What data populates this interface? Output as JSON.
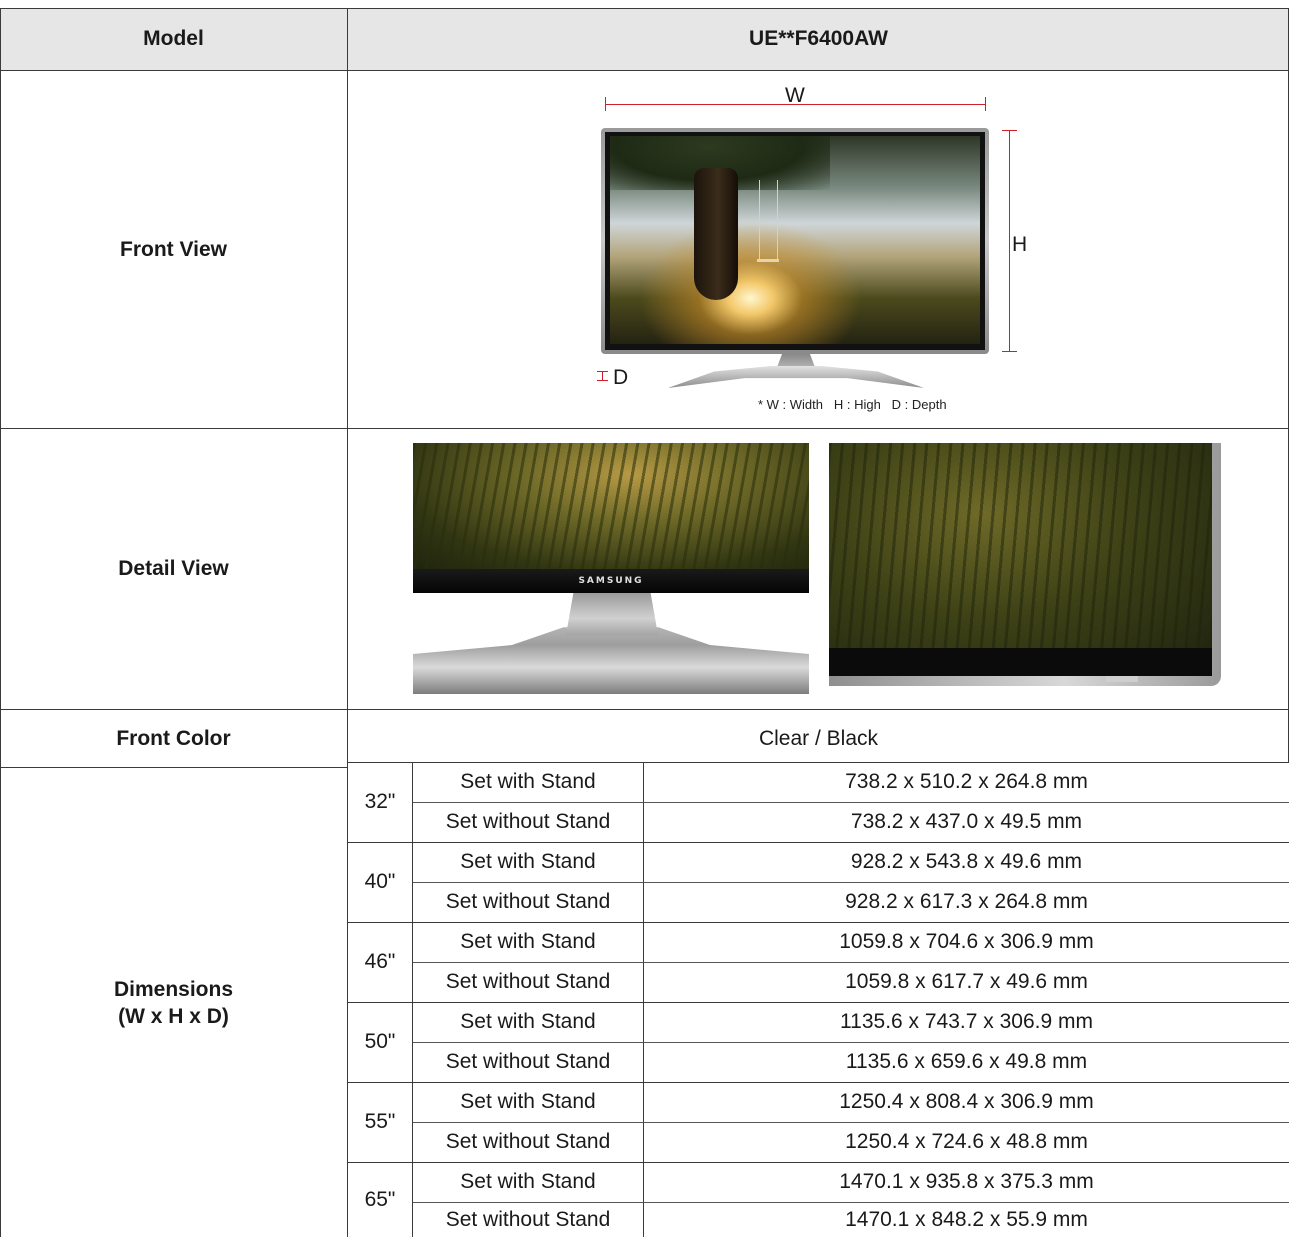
{
  "header": {
    "label": "Model",
    "model": "UE**F6400AW"
  },
  "front_view": {
    "label": "Front View",
    "width_marker": "W",
    "height_marker": "H",
    "depth_marker": "D",
    "legend": "* W : Width   H : High   D : Depth"
  },
  "detail_view": {
    "label": "Detail View",
    "brand_logo": "SAMSUNG"
  },
  "front_color": {
    "label": "Front Color",
    "value": "Clear / Black"
  },
  "dimensions": {
    "label_line1": "Dimensions",
    "label_line2": "(W x H x D)",
    "sizes": [
      {
        "size": "32\"",
        "rows": [
          {
            "type": "Set with Stand",
            "value": "738.2 x 510.2 x 264.8 mm"
          },
          {
            "type": "Set without Stand",
            "value": "738.2 x 437.0 x 49.5 mm"
          }
        ]
      },
      {
        "size": "40\"",
        "rows": [
          {
            "type": "Set with Stand",
            "value": "928.2 x 543.8 x 49.6 mm"
          },
          {
            "type": "Set without Stand",
            "value": "928.2 x 617.3 x 264.8 mm"
          }
        ]
      },
      {
        "size": "46\"",
        "rows": [
          {
            "type": "Set with Stand",
            "value": "1059.8 x 704.6 x 306.9 mm"
          },
          {
            "type": "Set without Stand",
            "value": "1059.8 x 617.7 x 49.6 mm"
          }
        ]
      },
      {
        "size": "50\"",
        "rows": [
          {
            "type": "Set with Stand",
            "value": "1135.6 x 743.7 x 306.9 mm"
          },
          {
            "type": "Set without Stand",
            "value": "1135.6 x 659.6 x 49.8 mm"
          }
        ]
      },
      {
        "size": "55\"",
        "rows": [
          {
            "type": "Set with Stand",
            "value": "1250.4 x 808.4 x 306.9 mm"
          },
          {
            "type": "Set without Stand",
            "value": "1250.4 x 724.6 x 48.8 mm"
          }
        ]
      },
      {
        "size": "65\"",
        "rows": [
          {
            "type": "Set with Stand",
            "value": "1470.1 x 935.8 x 375.3 mm"
          },
          {
            "type": "Set without Stand",
            "value": "1470.1 x 848.2 x 55.9 mm"
          }
        ]
      }
    ]
  },
  "colors": {
    "header_bg": "#e6e6e6",
    "dimension_marker": "#d01f2a",
    "grid_line": "#3a3a3a"
  }
}
